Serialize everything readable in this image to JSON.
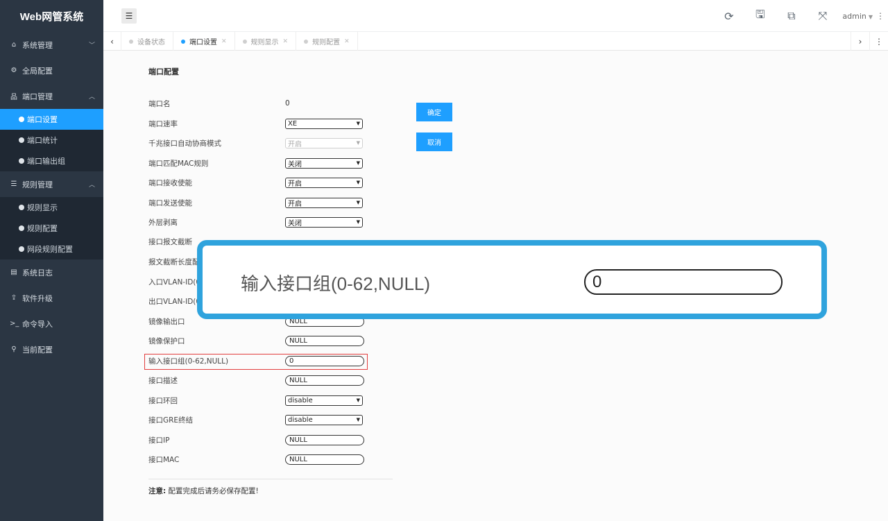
{
  "brand": "Web网管系统",
  "sidebar": {
    "items": [
      {
        "label": "系统管理",
        "icon": "home-icon"
      },
      {
        "label": "全局配置",
        "icon": "gears-icon"
      },
      {
        "label": "端口管理",
        "icon": "sitemap-icon"
      },
      {
        "label": "规则管理",
        "icon": "sliders-icon"
      },
      {
        "label": "系统日志",
        "icon": "file-icon"
      },
      {
        "label": "软件升级",
        "icon": "upload-icon"
      },
      {
        "label": "命令导入",
        "icon": "terminal-icon"
      },
      {
        "label": "当前配置",
        "icon": "map-marker-icon"
      }
    ],
    "port_sub": [
      "端口设置",
      "端口统计",
      "端口输出组"
    ],
    "rule_sub": [
      "规则显示",
      "规则配置",
      "网段规则配置"
    ]
  },
  "header": {
    "user": "admin"
  },
  "tabs": [
    {
      "label": "设备状态",
      "active": false,
      "closable": false
    },
    {
      "label": "端口设置",
      "active": true,
      "closable": true
    },
    {
      "label": "规则显示",
      "active": false,
      "closable": true
    },
    {
      "label": "规则配置",
      "active": false,
      "closable": true
    }
  ],
  "panel": {
    "title": "端口配置",
    "fields": [
      {
        "label": "端口名",
        "type": "text",
        "value": "0"
      },
      {
        "label": "端口速率",
        "type": "select",
        "value": "XE"
      },
      {
        "label": "千兆接口自动协商模式",
        "type": "select-disabled",
        "value": "开启"
      },
      {
        "label": "端口匹配MAC规则",
        "type": "select",
        "value": "关闭"
      },
      {
        "label": "端口接收使能",
        "type": "select",
        "value": "开启"
      },
      {
        "label": "端口发送使能",
        "type": "select",
        "value": "开启"
      },
      {
        "label": "外层剥离",
        "type": "select",
        "value": "关闭"
      },
      {
        "label": "接口报文截断",
        "type": "hidden",
        "value": ""
      },
      {
        "label": "报文截断长度配",
        "type": "hidden",
        "value": ""
      },
      {
        "label": "入口VLAN-ID(0",
        "type": "hidden",
        "value": ""
      },
      {
        "label": "出口VLAN-ID(0",
        "type": "hidden",
        "value": ""
      },
      {
        "label": "镜像输出口",
        "type": "input",
        "value": "NULL"
      },
      {
        "label": "镜像保护口",
        "type": "input",
        "value": "NULL"
      },
      {
        "label": "输入接口组(0-62,NULL)",
        "type": "input",
        "value": "0"
      },
      {
        "label": "接口描述",
        "type": "input",
        "value": "NULL"
      },
      {
        "label": "接口环回",
        "type": "select",
        "value": "disable"
      },
      {
        "label": "接口GRE终结",
        "type": "select",
        "value": "disable"
      },
      {
        "label": "接口IP",
        "type": "input",
        "value": "NULL"
      },
      {
        "label": "接口MAC",
        "type": "input",
        "value": "NULL"
      }
    ],
    "confirm_label": "确定",
    "cancel_label": "取消",
    "note_bold": "注意:",
    "note_text": "配置完成后请务必保存配置!"
  },
  "callout": {
    "label": "输入接口组(0-62,NULL)",
    "value": "0"
  },
  "colors": {
    "sidebar": "#2b3643",
    "accent": "#1e9fff",
    "callout": "#2fa3dd",
    "highlight": "#e23d3d"
  }
}
